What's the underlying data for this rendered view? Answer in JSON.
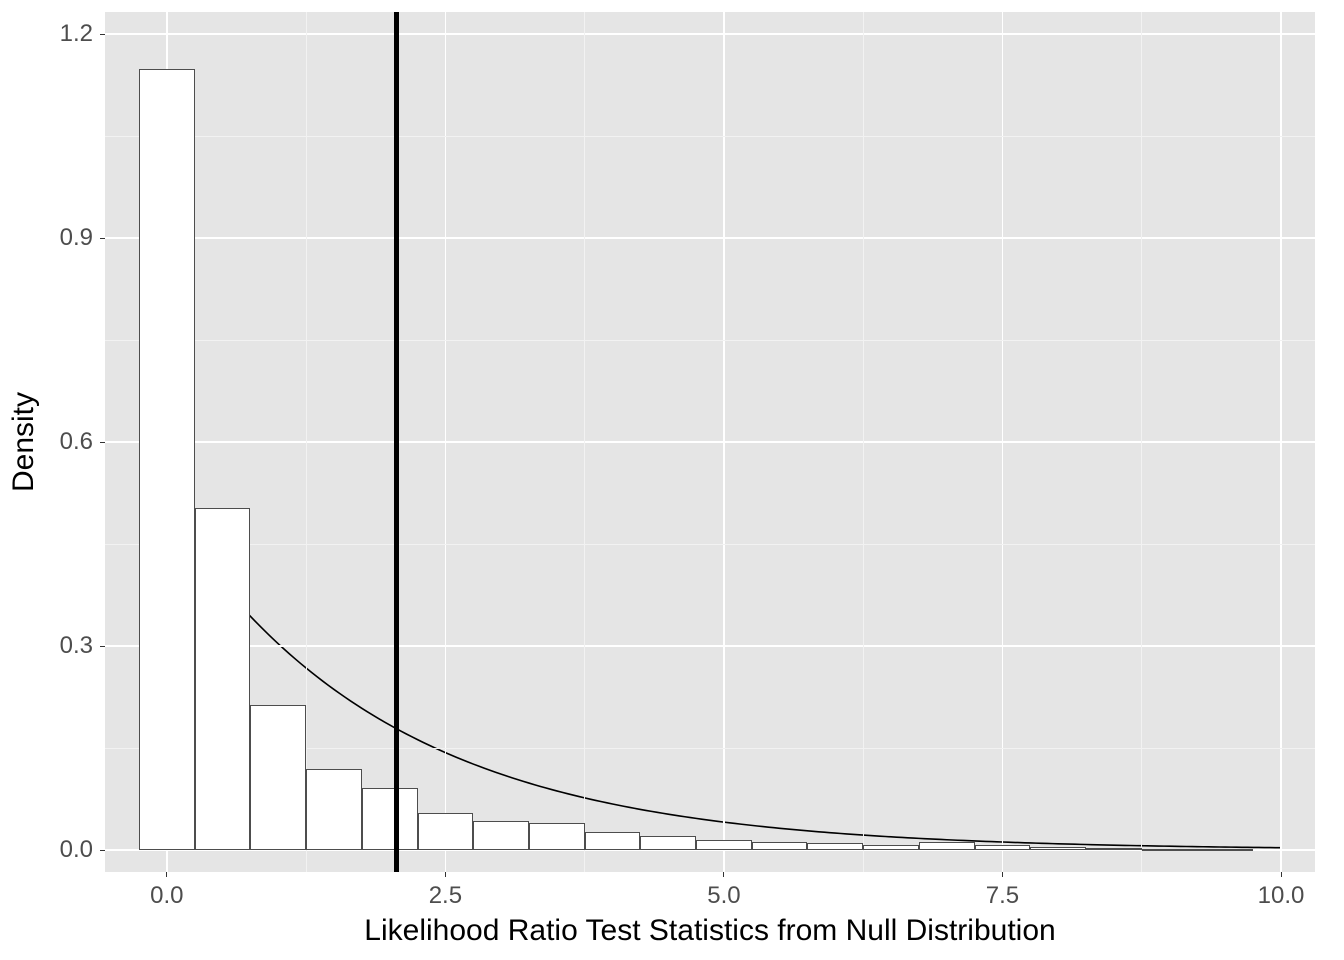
{
  "chart_data": {
    "type": "histogram-with-curve",
    "xlabel": "Likelihood Ratio Test Statistics from Null Distribution",
    "ylabel": "Density",
    "title": "",
    "xlim": [
      -0.25,
      10.0
    ],
    "ylim": [
      0,
      1.2
    ],
    "vline_x": 2.06,
    "x_ticks": [
      "0.0",
      "2.5",
      "5.0",
      "7.5",
      "10.0"
    ],
    "x_tick_vals": [
      0.0,
      2.5,
      5.0,
      7.5,
      10.0
    ],
    "y_ticks": [
      "0.0",
      "0.3",
      "0.6",
      "0.9",
      "1.2"
    ],
    "y_tick_vals": [
      0.0,
      0.3,
      0.6,
      0.9,
      1.2
    ],
    "x_minor_vals": [
      1.25,
      3.75,
      6.25,
      8.75
    ],
    "y_minor_vals": [
      0.15,
      0.45,
      0.75,
      1.05
    ],
    "bin_width": 0.5,
    "bars": [
      {
        "x0": -0.25,
        "x1": 0.25,
        "density": 1.148
      },
      {
        "x0": 0.25,
        "x1": 0.75,
        "density": 0.503
      },
      {
        "x0": 0.75,
        "x1": 1.25,
        "density": 0.213
      },
      {
        "x0": 1.25,
        "x1": 1.75,
        "density": 0.119
      },
      {
        "x0": 1.75,
        "x1": 2.25,
        "density": 0.091
      },
      {
        "x0": 2.25,
        "x1": 2.75,
        "density": 0.055
      },
      {
        "x0": 2.75,
        "x1": 3.25,
        "density": 0.042
      },
      {
        "x0": 3.25,
        "x1": 3.75,
        "density": 0.039
      },
      {
        "x0": 3.75,
        "x1": 4.25,
        "density": 0.027
      },
      {
        "x0": 4.25,
        "x1": 4.75,
        "density": 0.02
      },
      {
        "x0": 4.75,
        "x1": 5.25,
        "density": 0.014
      },
      {
        "x0": 5.25,
        "x1": 5.75,
        "density": 0.012
      },
      {
        "x0": 5.75,
        "x1": 6.25,
        "density": 0.01
      },
      {
        "x0": 6.25,
        "x1": 6.75,
        "density": 0.008
      },
      {
        "x0": 6.75,
        "x1": 7.25,
        "density": 0.012
      },
      {
        "x0": 7.25,
        "x1": 7.75,
        "density": 0.007
      },
      {
        "x0": 7.75,
        "x1": 8.25,
        "density": 0.004
      },
      {
        "x0": 8.25,
        "x1": 8.75,
        "density": 0.003
      },
      {
        "x0": 8.75,
        "x1": 9.25,
        "density": 0.002
      },
      {
        "x0": 9.25,
        "x1": 9.75,
        "density": 0.002
      }
    ],
    "curve_type": "chi-square-like density",
    "curve_x_start": 0.0,
    "curve_y_start": 0.5,
    "curve_half_life_x": 1.386
  },
  "colors": {
    "panel_bg": "#e5e5e5",
    "grid_major": "#ffffff",
    "grid_minor": "#f2f2f2",
    "bar_fill": "#ffffff",
    "bar_border": "#4d4d4d",
    "vline": "#000000",
    "curve": "#000000",
    "tick_text": "#4d4d4d",
    "axis_title": "#000000"
  }
}
